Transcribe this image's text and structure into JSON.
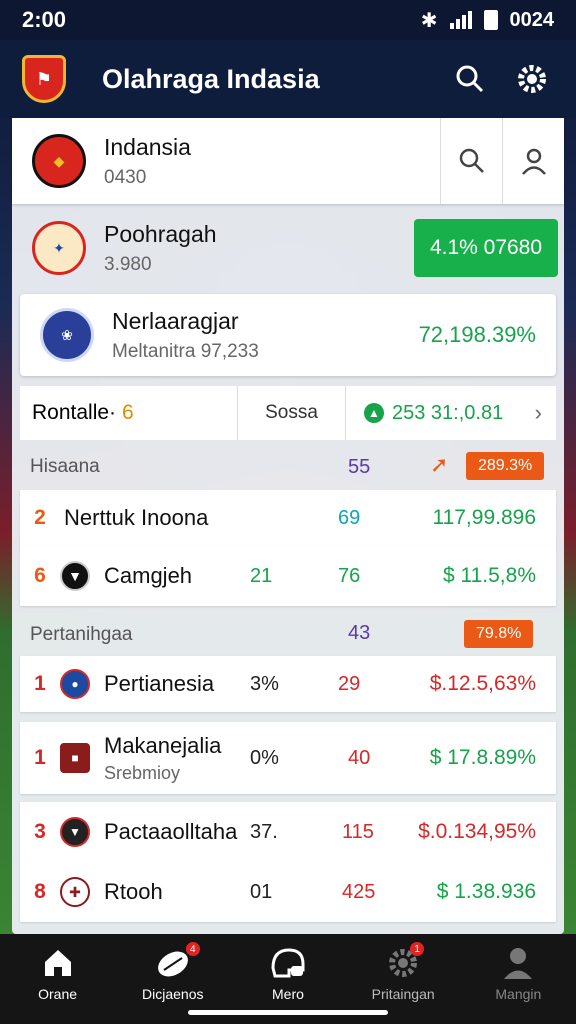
{
  "status": {
    "time": "2:00",
    "battery": "0024"
  },
  "app": {
    "title": "Olahraga Indasia"
  },
  "header_card": {
    "name": "Indansia",
    "sub": "0430"
  },
  "card2": {
    "name": "Poohragah",
    "sub": "3.980",
    "button": "4.1% 07680"
  },
  "card3": {
    "name": "Nerlaaragjar",
    "sub": "Meltanitra 97,233",
    "pct": "72,198.39%"
  },
  "summary": {
    "label": "Rontalle·",
    "count": "6",
    "middle": "Sossa",
    "value": "253 31:,0.81"
  },
  "section1": {
    "label": "Hisaana",
    "num": "55",
    "pill": "289.3%"
  },
  "rows1": [
    {
      "rank": "2",
      "name": "Nerttuk Inoona",
      "a": "",
      "b": "69",
      "c": "117,99.896"
    },
    {
      "rank": "6",
      "name": "Camgjeh",
      "a": "21",
      "b": "76",
      "c": "$ 11.5,8%"
    }
  ],
  "section2": {
    "label": "Pertanihgaa",
    "num": "43",
    "pill": "79.8%"
  },
  "rows2": [
    {
      "rank": "1",
      "name": "Pertianesia",
      "sub": "",
      "a": "3%",
      "b": "29",
      "c": "$.12.5,63%"
    },
    {
      "rank": "1",
      "name": "Makanejalia",
      "sub": "Srebmioy",
      "a": "0%",
      "b": "40",
      "c": "$ 17.8.89%"
    },
    {
      "rank": "3",
      "name": "Pactaaolltaha",
      "sub": "",
      "a": "37.",
      "b": "115",
      "c": "$.0.134,95%"
    },
    {
      "rank": "8",
      "name": "Rtooh",
      "sub": "",
      "a": "01",
      "b": "425",
      "c": "$ 1.38.936"
    }
  ],
  "nav": [
    {
      "label": "Orane",
      "icon": "home-icon"
    },
    {
      "label": "Dicjaenos",
      "icon": "ball-icon",
      "badge": "4"
    },
    {
      "label": "Mero",
      "icon": "helmet-icon"
    },
    {
      "label": "Pritaingan",
      "icon": "gear-icon",
      "badge": "1"
    },
    {
      "label": "Mangin",
      "icon": "profile-icon"
    }
  ],
  "colors": {
    "green": "#16a34a",
    "red": "#d62828",
    "orange": "#ea5a16",
    "purple": "#5b3aa8",
    "teal": "#0ea5b7"
  }
}
